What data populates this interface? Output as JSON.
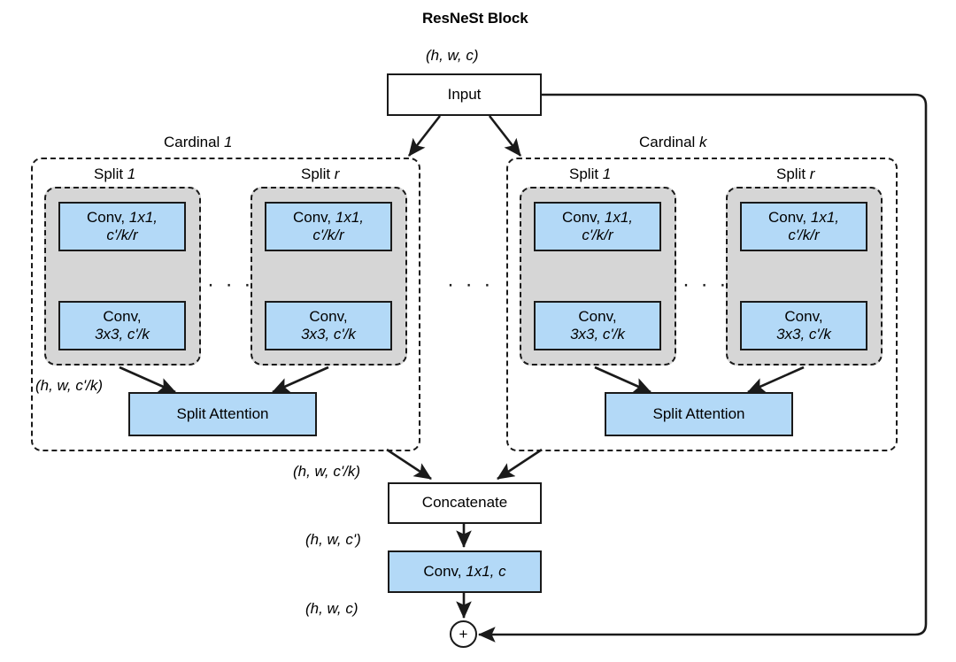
{
  "diagram": {
    "title": "ResNeSt Block",
    "input_box": {
      "label": "Input"
    },
    "tensor_shapes": {
      "input": "(h, w, c)",
      "cardinal_out": "(h, w, c'/k)",
      "concat_in": "(h, w, c'/k)",
      "concat_out": "(h, w, c')",
      "final": "(h, w, c)"
    },
    "ellipsis": "· · ·",
    "plus_symbol": "+",
    "cardinals": [
      {
        "label_prefix": "Cardinal ",
        "label_index": "1",
        "shape_label": "(h, w, c'/k)",
        "splits": [
          {
            "label_prefix": "Split ",
            "label_index": "1",
            "conv1": {
              "line1": "Conv, ",
              "line1_em": "1x1,",
              "line2_em": "c'/k/r"
            },
            "conv2": {
              "line1": "Conv,",
              "line2_em": "3x3, c'/k"
            }
          },
          {
            "label_prefix": "Split ",
            "label_index": "r",
            "conv1": {
              "line1": "Conv, ",
              "line1_em": "1x1,",
              "line2_em": "c'/k/r"
            },
            "conv2": {
              "line1": "Conv,",
              "line2_em": "3x3, c'/k"
            }
          }
        ],
        "attention": {
          "label": "Split Attention"
        }
      },
      {
        "label_prefix": "Cardinal ",
        "label_index": "k",
        "shape_label": "",
        "splits": [
          {
            "label_prefix": "Split ",
            "label_index": "1",
            "conv1": {
              "line1": "Conv, ",
              "line1_em": "1x1,",
              "line2_em": "c'/k/r"
            },
            "conv2": {
              "line1": "Conv,",
              "line2_em": "3x3, c'/k"
            }
          },
          {
            "label_prefix": "Split ",
            "label_index": "r",
            "conv1": {
              "line1": "Conv, ",
              "line1_em": "1x1,",
              "line2_em": "c'/k/r"
            },
            "conv2": {
              "line1": "Conv,",
              "line2_em": "3x3, c'/k"
            }
          }
        ],
        "attention": {
          "label": "Split Attention"
        }
      }
    ],
    "concatenate_box": {
      "label": "Concatenate"
    },
    "final_conv_box": {
      "line1": "Conv, ",
      "line1_em": "1x1, c"
    },
    "colors": {
      "blue_fill": "#b3d9f7",
      "gray_fill": "#d6d6d6",
      "stroke": "#1a1a1a",
      "background": "#ffffff"
    }
  }
}
